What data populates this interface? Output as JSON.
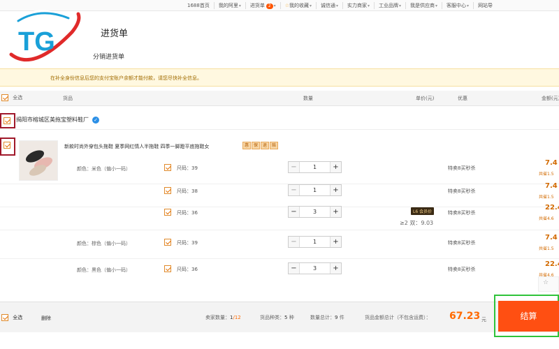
{
  "topnav": {
    "items": [
      {
        "label": "1688首页",
        "dropdown": false
      },
      {
        "label": "我的阿里",
        "dropdown": true
      },
      {
        "label": "进货单",
        "badge": "2",
        "dropdown": true
      },
      {
        "label": "我的收藏",
        "dropdown": true
      },
      {
        "label": "诚信通",
        "dropdown": true
      },
      {
        "label": "实力商家",
        "dropdown": true
      },
      {
        "label": "工业品牌",
        "dropdown": true
      },
      {
        "label": "我是供应商",
        "dropdown": true
      },
      {
        "label": "客服中心",
        "dropdown": true
      },
      {
        "label": "网站导",
        "dropdown": false
      }
    ]
  },
  "logo": {
    "text": "TG",
    "colors": {
      "blue": "#1aa0d8",
      "red": "#e02a2a"
    }
  },
  "header": {
    "title": "进货单",
    "tab_secondary": "分销进货单"
  },
  "notice": {
    "text": "在补全身份信息后您的支付宝账户余额才能付款，请您尽快补全信息。"
  },
  "table_header": {
    "select_all": "全选",
    "columns": [
      "货品",
      "数量",
      "单价(元)",
      "优惠",
      "金额(元)"
    ]
  },
  "store": {
    "name": "揭阳市榕城区美拖宝塑料鞋厂"
  },
  "product": {
    "title": "新款时尚外穿包头拖鞋 夏季网红情人半拖鞋 四季一脚蹬平底拖鞋女",
    "tags": [
      "惠",
      "保",
      "退",
      "赔"
    ],
    "member_badge": "L6 会员价",
    "tier_price": "≥2 双：9.03",
    "skus": [
      {
        "color": "颜色：米色（偏小一码）",
        "size": "尺码：39",
        "qty": "1",
        "promo": "特卖8买秒杀",
        "price": "7.4",
        "saved": "共省1.5"
      },
      {
        "color": "",
        "size": "尺码：38",
        "qty": "1",
        "promo": "特卖8买秒杀",
        "price": "7.4",
        "saved": "共省1.5"
      },
      {
        "color": "",
        "size": "尺码：36",
        "qty": "3",
        "promo": "特卖8买秒杀",
        "price": "22.4",
        "saved": "共省4.6"
      },
      {
        "color": "颜色：棕色（偏小一码）",
        "size": "尺码：39",
        "qty": "1",
        "promo": "特卖8买秒杀",
        "price": "7.4",
        "saved": "共省1.5"
      },
      {
        "color": "颜色：黑色（偏小一码）",
        "size": "尺码：36",
        "qty": "3",
        "promo": "特卖8买秒杀",
        "price": "22.4",
        "saved": "共省4.6"
      }
    ]
  },
  "footer": {
    "select_all": "全选",
    "delete": "删除",
    "seller_count_label": "卖家数量：",
    "seller_selected": "1",
    "seller_total": "/12",
    "kinds_label": "货品种类：",
    "kinds": "5",
    "kinds_unit": "种",
    "qty_label": "数量总计：",
    "qty": "9",
    "qty_unit": "件",
    "total_label": "货品金额总计（不包含运费）：",
    "total": "67.23",
    "currency": "元",
    "checkout": "结算"
  },
  "colors": {
    "accent": "#ff4f12",
    "highlight_red": "#a0182a",
    "highlight_green": "#2fc33a",
    "price": "#d26a00"
  }
}
